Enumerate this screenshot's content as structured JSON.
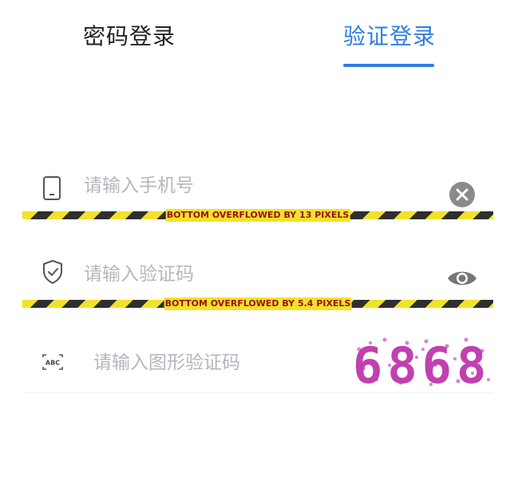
{
  "tabs": {
    "password_login": "密码登录",
    "code_login": "验证登录"
  },
  "phone": {
    "placeholder": "请输入手机号"
  },
  "sms_code": {
    "placeholder": "请输入验证码"
  },
  "image_code": {
    "placeholder": "请输入图形验证码",
    "icon_text": "ABC",
    "captcha_text": "6868"
  },
  "overflow_warnings": {
    "first": "BOTTOM OVERFLOWED BY 13 PIXELS",
    "second": "BOTTOM OVERFLOWED BY 5.4 PIXELS"
  },
  "colors": {
    "accent": "#2f7de1",
    "captcha": "#c040b0"
  }
}
